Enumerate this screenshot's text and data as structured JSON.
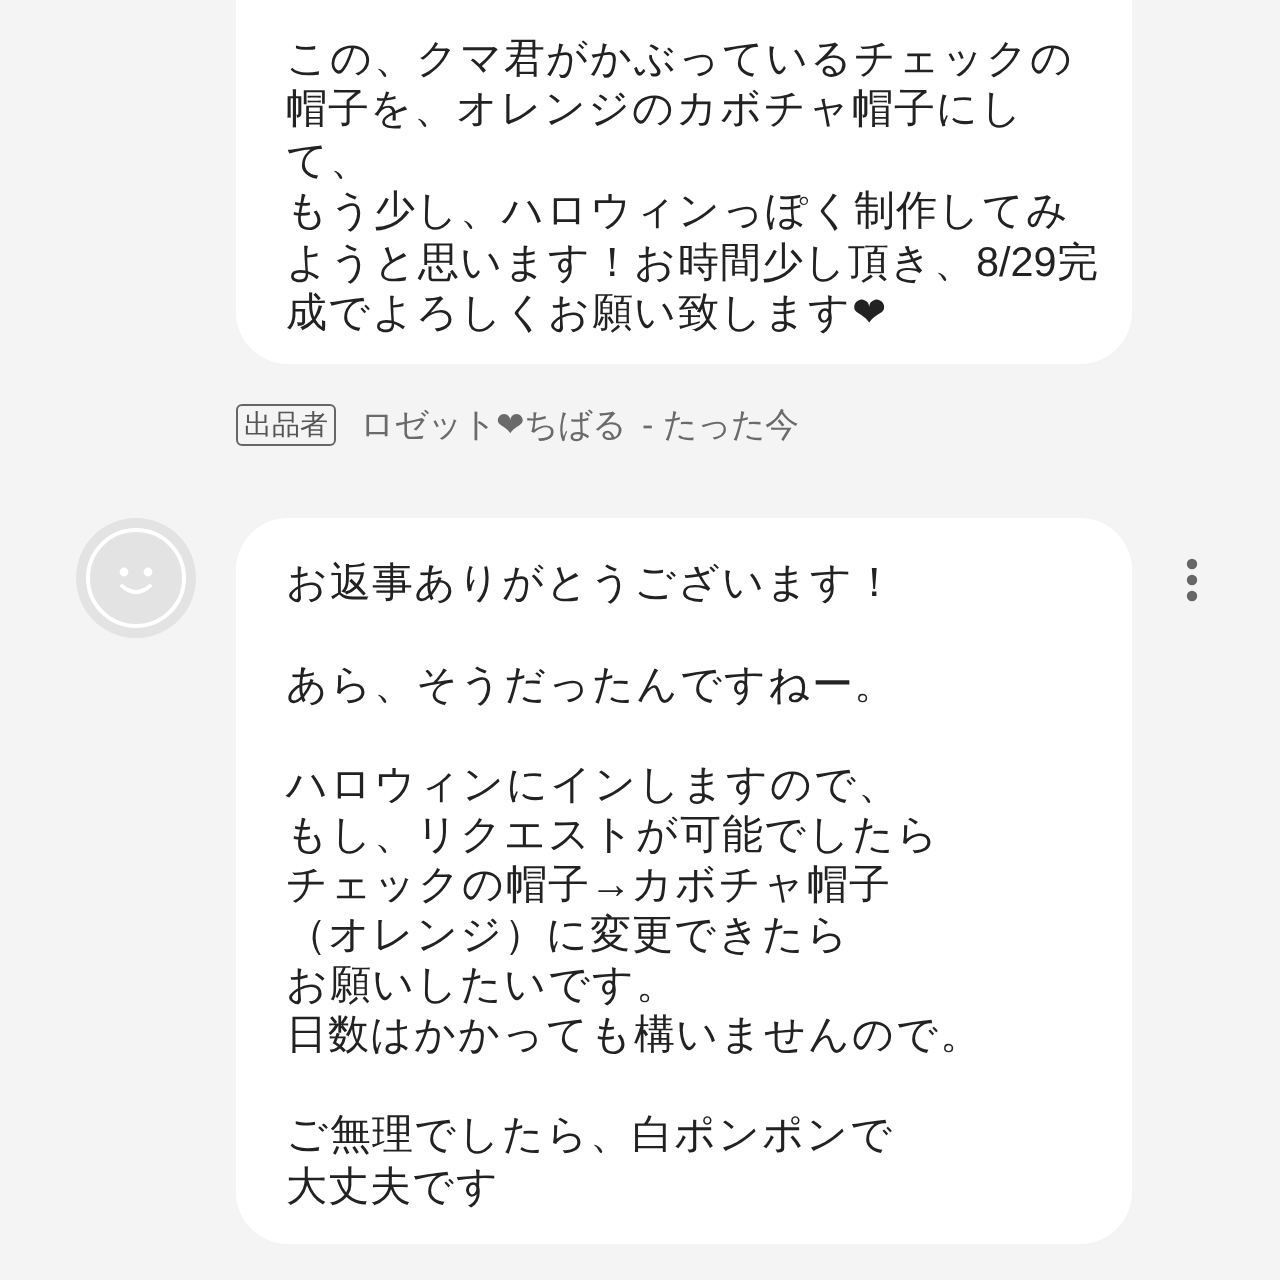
{
  "messages": [
    {
      "paragraphs": [
        [
          "この、クマ君がかぶっているチェックの帽子を、オレンジのカボチャ帽子にして、",
          "もう少し、ハロウィンっぽく制作してみようと思います！お時間少し頂き、8/29完成でよろしくお願い致します❤"
        ]
      ],
      "cut_top": true,
      "avatar": false,
      "menu": false,
      "meta": {
        "badge": "出品者",
        "sender": "ロゼット❤ちばる",
        "time": "- たった今"
      }
    },
    {
      "paragraphs": [
        [
          "お返事ありがとうございます！"
        ],
        [
          "あら、そうだったんですねー。"
        ],
        [
          "ハロウィンにインしますので、",
          "もし、リクエストが可能でしたら",
          "チェックの帽子→カボチャ帽子",
          "（オレンジ）に変更できたら",
          "お願いしたいです。",
          "日数はかかっても構いませんので。"
        ],
        [
          "ご無理でしたら、白ポンポンで",
          "大丈夫です"
        ]
      ],
      "cut_top": false,
      "avatar": true,
      "menu": true
    }
  ]
}
